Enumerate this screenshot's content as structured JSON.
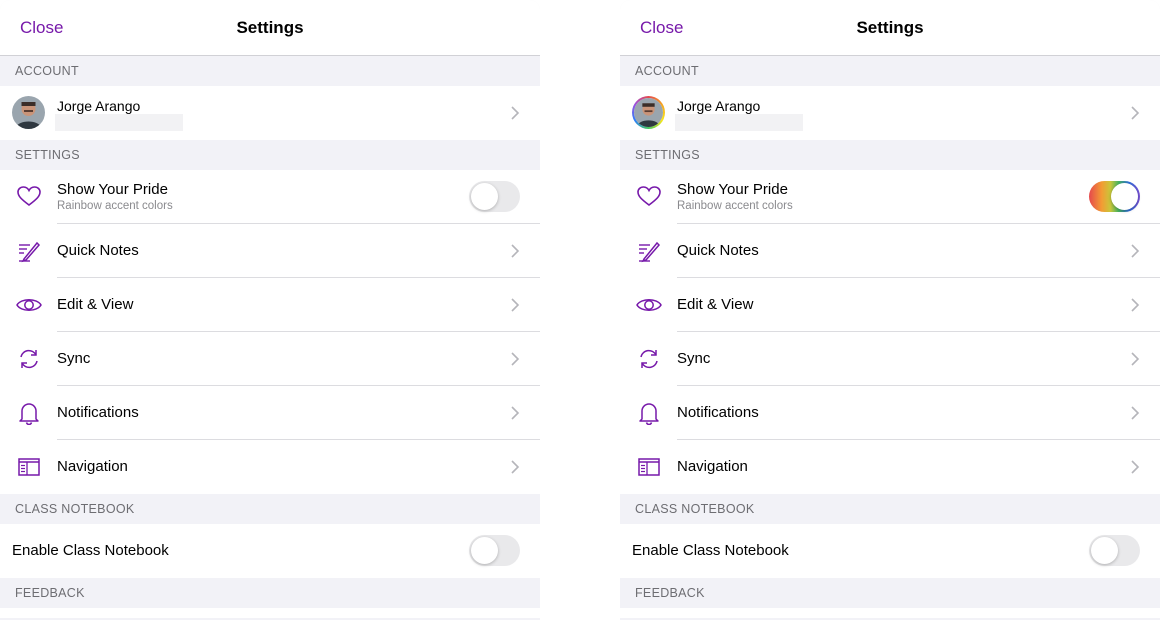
{
  "panels": [
    {
      "variant": "pride-off",
      "nav": {
        "close_label": "Close",
        "title": "Settings"
      },
      "sections": {
        "account": "ACCOUNT",
        "settings": "SETTINGS",
        "class_notebook": "CLASS NOTEBOOK",
        "feedback": "FEEDBACK"
      },
      "account": {
        "name": "Jorge Arango",
        "avatar_ring": false
      },
      "pride": {
        "label": "Show Your Pride",
        "subtitle": "Rainbow accent colors",
        "enabled": false
      },
      "items": [
        {
          "label": "Quick Notes",
          "icon": "quick-notes-icon"
        },
        {
          "label": "Edit & View",
          "icon": "eye-icon"
        },
        {
          "label": "Sync",
          "icon": "sync-icon"
        },
        {
          "label": "Notifications",
          "icon": "bell-icon"
        },
        {
          "label": "Navigation",
          "icon": "navigation-icon"
        }
      ],
      "class_notebook": {
        "label": "Enable Class Notebook",
        "enabled": false
      }
    },
    {
      "variant": "pride-on",
      "nav": {
        "close_label": "Close",
        "title": "Settings"
      },
      "sections": {
        "account": "ACCOUNT",
        "settings": "SETTINGS",
        "class_notebook": "CLASS NOTEBOOK",
        "feedback": "FEEDBACK"
      },
      "account": {
        "name": "Jorge Arango",
        "avatar_ring": true
      },
      "pride": {
        "label": "Show Your Pride",
        "subtitle": "Rainbow accent colors",
        "enabled": true
      },
      "items": [
        {
          "label": "Quick Notes",
          "icon": "quick-notes-icon"
        },
        {
          "label": "Edit & View",
          "icon": "eye-icon"
        },
        {
          "label": "Sync",
          "icon": "sync-icon"
        },
        {
          "label": "Notifications",
          "icon": "bell-icon"
        },
        {
          "label": "Navigation",
          "icon": "navigation-icon"
        }
      ],
      "class_notebook": {
        "label": "Enable Class Notebook",
        "enabled": false
      }
    }
  ],
  "colors": {
    "accent": "#7719aa",
    "background": "#f2f2f7",
    "separator": "#dcdce0",
    "section_text": "#6d6d72"
  }
}
